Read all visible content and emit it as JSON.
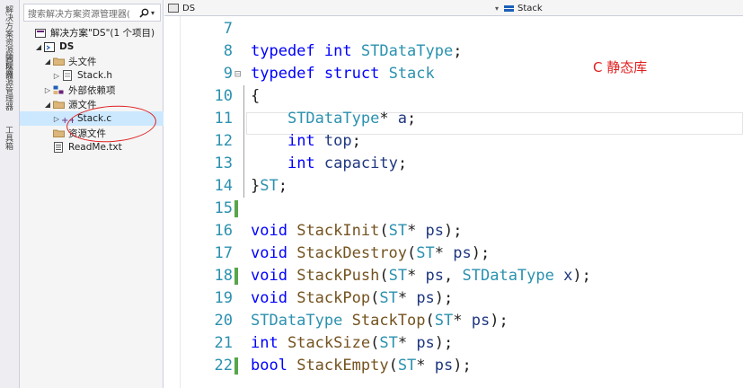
{
  "left_strip": {
    "tabs": [
      "解决方案资源管理器",
      "团队资源管理器",
      "工具箱"
    ]
  },
  "explorer": {
    "search_placeholder": "搜索解决方案资源管理器(",
    "tree": [
      {
        "label": "解决方案\"DS\"(1 个项目)",
        "icon": "solution-icon",
        "indent": 0,
        "arrow": ""
      },
      {
        "label": "DS",
        "icon": "project-icon",
        "indent": 1,
        "arrow": "◢"
      },
      {
        "label": "头文件",
        "icon": "folder-icon",
        "indent": 2,
        "arrow": "◢"
      },
      {
        "label": "Stack.h",
        "icon": "header-file-icon",
        "indent": 3,
        "arrow": "▷"
      },
      {
        "label": "外部依赖项",
        "icon": "dependency-icon",
        "indent": 2,
        "arrow": "▷"
      },
      {
        "label": "源文件",
        "icon": "folder-icon",
        "indent": 2,
        "arrow": "◢"
      },
      {
        "label": "Stack.c",
        "icon": "cpp-file-icon",
        "indent": 3,
        "arrow": "▷",
        "selected": true
      },
      {
        "label": "资源文件",
        "icon": "folder-icon",
        "indent": 2,
        "arrow": ""
      },
      {
        "label": "ReadMe.txt",
        "icon": "text-file-icon",
        "indent": 2,
        "arrow": ""
      }
    ]
  },
  "topbar": {
    "project_combo": "DS",
    "scope_combo": "Stack"
  },
  "annotation": "C  静态库",
  "colors": {
    "keyword": "#0000ff",
    "type": "#2b91af",
    "function": "#74531f",
    "param": "#1f377f",
    "annotation": "#e02020",
    "change_bar": "#57a64a"
  },
  "code_lines": [
    {
      "n": "7",
      "tokens": []
    },
    {
      "n": "8",
      "tokens": [
        [
          "kw",
          "typedef"
        ],
        [
          "pl",
          " "
        ],
        [
          "kw",
          "int"
        ],
        [
          "pl",
          " "
        ],
        [
          "ty",
          "STDataType"
        ],
        [
          "pl",
          ";"
        ]
      ]
    },
    {
      "n": "9",
      "fold": "⊟",
      "tokens": [
        [
          "kw",
          "typedef"
        ],
        [
          "pl",
          " "
        ],
        [
          "kw",
          "struct"
        ],
        [
          "pl",
          " "
        ],
        [
          "ty",
          "Stack"
        ]
      ]
    },
    {
      "n": "10",
      "tokens": [
        [
          "pl",
          "{"
        ]
      ]
    },
    {
      "n": "11",
      "tokens": [
        [
          "pl",
          "    "
        ],
        [
          "ty",
          "STDataType"
        ],
        [
          "pl",
          "* "
        ],
        [
          "pm",
          "a"
        ],
        [
          "pl",
          ";"
        ]
      ]
    },
    {
      "n": "12",
      "tokens": [
        [
          "pl",
          "    "
        ],
        [
          "kw",
          "int"
        ],
        [
          "pl",
          " "
        ],
        [
          "pm",
          "top"
        ],
        [
          "pl",
          ";"
        ]
      ]
    },
    {
      "n": "13",
      "tokens": [
        [
          "pl",
          "    "
        ],
        [
          "kw",
          "int"
        ],
        [
          "pl",
          " "
        ],
        [
          "pm",
          "capacity"
        ],
        [
          "pl",
          ";"
        ]
      ]
    },
    {
      "n": "14",
      "tokens": [
        [
          "pl",
          "}"
        ],
        [
          "ty",
          "ST"
        ],
        [
          "pl",
          ";"
        ]
      ]
    },
    {
      "n": "15",
      "change": true,
      "tokens": []
    },
    {
      "n": "16",
      "tokens": [
        [
          "kw",
          "void"
        ],
        [
          "pl",
          " "
        ],
        [
          "fn",
          "StackInit"
        ],
        [
          "pl",
          "("
        ],
        [
          "ty",
          "ST"
        ],
        [
          "pl",
          "* "
        ],
        [
          "pm",
          "ps"
        ],
        [
          "pl",
          ");"
        ]
      ]
    },
    {
      "n": "17",
      "tokens": [
        [
          "kw",
          "void"
        ],
        [
          "pl",
          " "
        ],
        [
          "fn",
          "StackDestroy"
        ],
        [
          "pl",
          "("
        ],
        [
          "ty",
          "ST"
        ],
        [
          "pl",
          "* "
        ],
        [
          "pm",
          "ps"
        ],
        [
          "pl",
          ");"
        ]
      ]
    },
    {
      "n": "18",
      "change": true,
      "tokens": [
        [
          "kw",
          "void"
        ],
        [
          "pl",
          " "
        ],
        [
          "fn",
          "StackPush"
        ],
        [
          "pl",
          "("
        ],
        [
          "ty",
          "ST"
        ],
        [
          "pl",
          "* "
        ],
        [
          "pm",
          "ps"
        ],
        [
          "pl",
          ", "
        ],
        [
          "ty",
          "STDataType"
        ],
        [
          "pl",
          " "
        ],
        [
          "pm",
          "x"
        ],
        [
          "pl",
          ");"
        ]
      ]
    },
    {
      "n": "19",
      "tokens": [
        [
          "kw",
          "void"
        ],
        [
          "pl",
          " "
        ],
        [
          "fn",
          "StackPop"
        ],
        [
          "pl",
          "("
        ],
        [
          "ty",
          "ST"
        ],
        [
          "pl",
          "* "
        ],
        [
          "pm",
          "ps"
        ],
        [
          "pl",
          ");"
        ]
      ]
    },
    {
      "n": "20",
      "tokens": [
        [
          "ty",
          "STDataType"
        ],
        [
          "pl",
          " "
        ],
        [
          "fn",
          "StackTop"
        ],
        [
          "pl",
          "("
        ],
        [
          "ty",
          "ST"
        ],
        [
          "pl",
          "* "
        ],
        [
          "pm",
          "ps"
        ],
        [
          "pl",
          ");"
        ]
      ]
    },
    {
      "n": "21",
      "tokens": [
        [
          "kw",
          "int"
        ],
        [
          "pl",
          " "
        ],
        [
          "fn",
          "StackSize"
        ],
        [
          "pl",
          "("
        ],
        [
          "ty",
          "ST"
        ],
        [
          "pl",
          "* "
        ],
        [
          "pm",
          "ps"
        ],
        [
          "pl",
          ");"
        ]
      ]
    },
    {
      "n": "22",
      "change": true,
      "tokens": [
        [
          "kw",
          "bool"
        ],
        [
          "pl",
          " "
        ],
        [
          "fn",
          "StackEmpty"
        ],
        [
          "pl",
          "("
        ],
        [
          "ty",
          "ST"
        ],
        [
          "pl",
          "* "
        ],
        [
          "pm",
          "ps"
        ],
        [
          "pl",
          ");"
        ]
      ]
    }
  ]
}
